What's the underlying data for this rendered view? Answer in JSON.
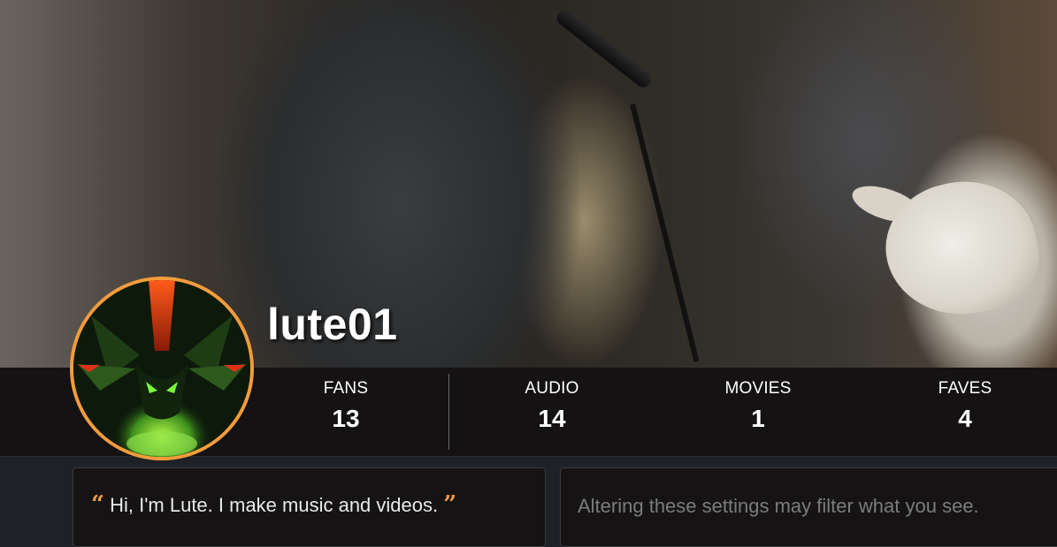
{
  "profile": {
    "username": "lute01",
    "quote": "Hi, I'm Lute. I make music and videos.",
    "quote_open": "“",
    "quote_close": "”"
  },
  "stats": [
    {
      "label": "FANS",
      "value": "13"
    },
    {
      "label": "AUDIO",
      "value": "14"
    },
    {
      "label": "MOVIES",
      "value": "1"
    },
    {
      "label": "FAVES",
      "value": "4"
    }
  ],
  "filter_panel": {
    "message": "Altering these settings may filter what you see."
  },
  "colors": {
    "accent": "#f39c3c",
    "bar_bg": "#151213",
    "page_bg": "#1e2126"
  },
  "icons": {
    "avatar": "shadow-character-avatar"
  }
}
